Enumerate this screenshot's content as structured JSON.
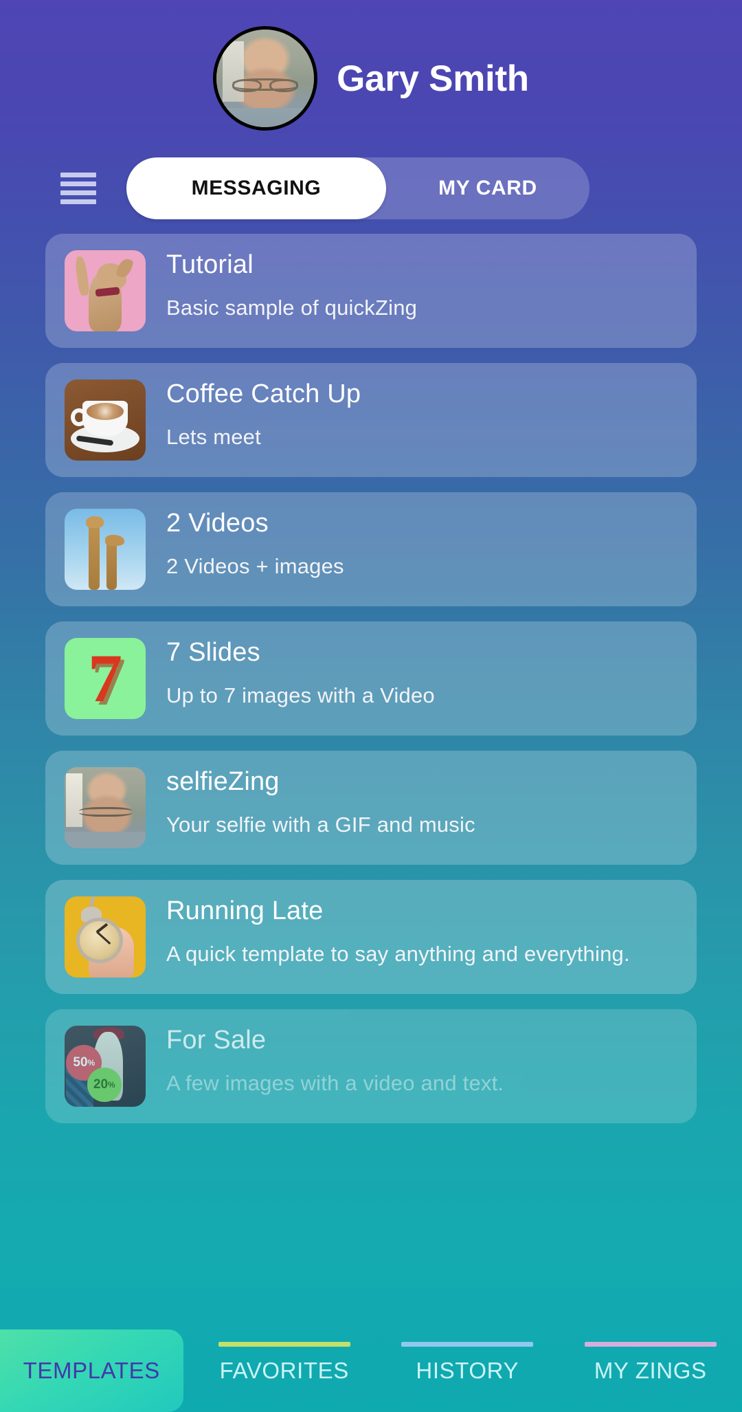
{
  "header": {
    "user_name": "Gary Smith",
    "avatar_alt": "user-avatar-photo"
  },
  "top_tabs": {
    "menu_icon": "hamburger-menu-icon",
    "items": [
      {
        "label": "MESSAGING",
        "active": true
      },
      {
        "label": "MY CARD",
        "active": false
      }
    ]
  },
  "templates": [
    {
      "title": "Tutorial",
      "subtitle": "Basic sample of quickZing",
      "thumb": "dog-waving-thumbnail",
      "thumb_class": "t-dog",
      "faded": false
    },
    {
      "title": "Coffee Catch Up",
      "subtitle": "Lets meet",
      "thumb": "latte-coffee-cup-thumbnail",
      "thumb_class": "t-coffee",
      "faded": false
    },
    {
      "title": "2 Videos",
      "subtitle": "2 Videos + images",
      "thumb": "two-giraffes-thumbnail",
      "thumb_class": "t-giraffe",
      "faded": false
    },
    {
      "title": "7 Slides",
      "subtitle": "Up to 7 images with a Video",
      "thumb": "number-seven-thumbnail",
      "thumb_class": "t-seven",
      "thumb_text": "7",
      "faded": false
    },
    {
      "title": "selfieZing",
      "subtitle": "Your selfie with a GIF and music",
      "thumb": "selfie-portrait-thumbnail",
      "thumb_class": "t-selfie",
      "faded": false
    },
    {
      "title": "Running Late",
      "subtitle": "A quick template to say anything and everything.",
      "thumb": "alarm-clock-in-hand-thumbnail",
      "thumb_class": "t-clock",
      "faded": false
    },
    {
      "title": "For Sale",
      "subtitle": "A few images with a video and text.",
      "thumb": "sale-mannequin-thumbnail",
      "thumb_class": "t-sale",
      "badge_high": "50",
      "badge_low": "20",
      "badge_suffix": "%",
      "faded": true
    }
  ],
  "bottom_nav": [
    {
      "label": "TEMPLATES",
      "active": true,
      "indicator_color": ""
    },
    {
      "label": "FAVORITES",
      "active": false,
      "indicator_color": "#c3e06a"
    },
    {
      "label": "HISTORY",
      "active": false,
      "indicator_color": "#8fc9f0"
    },
    {
      "label": "MY ZINGS",
      "active": false,
      "indicator_color": "#d5aede"
    }
  ],
  "colors": {
    "gradient_top": "#4f45b4",
    "gradient_bottom": "#0fa9b0",
    "active_tab_bg": "#ffffff",
    "active_nav_text": "#4338a8"
  }
}
